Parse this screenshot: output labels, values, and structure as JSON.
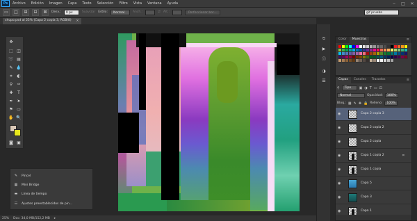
{
  "menubar": {
    "logo": "Ps",
    "items": [
      "Archivo",
      "Edición",
      "Imagen",
      "Capa",
      "Texto",
      "Selección",
      "Filtro",
      "Vista",
      "Ventana",
      "Ayuda"
    ],
    "controls": [
      "‒",
      "□",
      "✕"
    ]
  },
  "options": {
    "feather_label": "Desv.:",
    "feather_value": "0 px",
    "smooth_label": "Suavizar",
    "style_label": "Estilo:",
    "style_value": "Normal",
    "width_label": "Anch.:",
    "height_label": "Alt.:",
    "refine_button": "Perfeccionar bor...",
    "workspace": "gif prueba"
  },
  "document": {
    "tab_title": "chupo.psd al 25% (Capa 2 copia 3, RGB/8)",
    "close": "×"
  },
  "status": {
    "zoom": "25%",
    "doc_size": "Doc: 34,0 MB/152,2 MB"
  },
  "collapsed_panels": {
    "items": [
      "Pincel",
      "Mini Bridge",
      "Línea de tiempo",
      "Ajustes preestablecidos de pin..."
    ]
  },
  "color_panel": {
    "tabs": [
      "Color",
      "Muestras"
    ],
    "active_tab": "Muestras",
    "swatches": [
      "#ff0000",
      "#ffff00",
      "#00ff00",
      "#00ffff",
      "#0000ff",
      "#ff00ff",
      "#ffffff",
      "#e6e6e6",
      "#cccccc",
      "#b3b3b3",
      "#999999",
      "#808080",
      "#666666",
      "#4d4d4d",
      "#333333",
      "#000000",
      "#ed1c24",
      "#f26522",
      "#f7941d",
      "#fff200",
      "#8dc63f",
      "#39b54a",
      "#00a651",
      "#00a99d",
      "#00aeef",
      "#0072bc",
      "#0054a6",
      "#2e3192",
      "#662d91",
      "#92278f",
      "#ec008c",
      "#ed145b",
      "#f26c4f",
      "#f68e56",
      "#fbaf5c",
      "#fff467",
      "#acd372",
      "#7cc576",
      "#3bb878",
      "#1abbb4",
      "#00bff3",
      "#438ccb",
      "#5574b9",
      "#605ca8",
      "#855fa8",
      "#a763a8",
      "#f06ea9",
      "#f26d7d",
      "#9e0b0f",
      "#a0410d",
      "#a3620a",
      "#aba000",
      "#598527",
      "#197b30",
      "#007236",
      "#00746b",
      "#0076a3",
      "#004b80",
      "#003471",
      "#1b1464",
      "#440e62",
      "#630460",
      "#9e005d",
      "#9e0039",
      "#790000",
      "#7b2e00",
      "#7d4900",
      "#827b00",
      "#406618",
      "#005e20",
      "#005826",
      "#005952",
      "#005b7f",
      "#003663",
      "#002157",
      "#0d004c",
      "#32004b",
      "#4b0049",
      "#7b0046",
      "#7a0026",
      "#c69c6d",
      "#a67c52",
      "#8c6239",
      "#754c24",
      "#603913",
      "#998675",
      "#736357",
      "#534741",
      "#362f2d",
      "#c7b299",
      "#998675",
      "#ffffff",
      "#f2f2f2",
      "#d9d9d9",
      "#bfbfbf",
      "#a6a6a6"
    ]
  },
  "layers_panel": {
    "tabs": [
      "Capas",
      "Canales",
      "Trazados"
    ],
    "active_tab": "Capas",
    "filter_label": "Tipo",
    "blend_mode": "Normal",
    "opacity_label": "Opacidad:",
    "opacity_value": "100%",
    "lock_label": "Bloq.:",
    "fill_label": "Relleno:",
    "fill_value": "100%",
    "layers": [
      {
        "name": "Capa 2 copia 3",
        "selected": true,
        "thumb": "checker",
        "fx": ""
      },
      {
        "name": "Capa 2 copia 2",
        "selected": false,
        "thumb": "checker",
        "fx": ""
      },
      {
        "name": "Capa 2 copia",
        "selected": false,
        "thumb": "checker",
        "fx": ""
      },
      {
        "name": "Capa 1 copia 2",
        "selected": false,
        "thumb": "figure",
        "fx": "⌗"
      },
      {
        "name": "Capa 1 copia",
        "selected": false,
        "thumb": "figure",
        "fx": ""
      },
      {
        "name": "Capa 5",
        "selected": false,
        "thumb": "blue",
        "fx": ""
      },
      {
        "name": "Capa 3",
        "selected": false,
        "thumb": "teal",
        "fx": ""
      },
      {
        "name": "Capa 1",
        "selected": false,
        "thumb": "figure",
        "fx": ""
      }
    ]
  }
}
